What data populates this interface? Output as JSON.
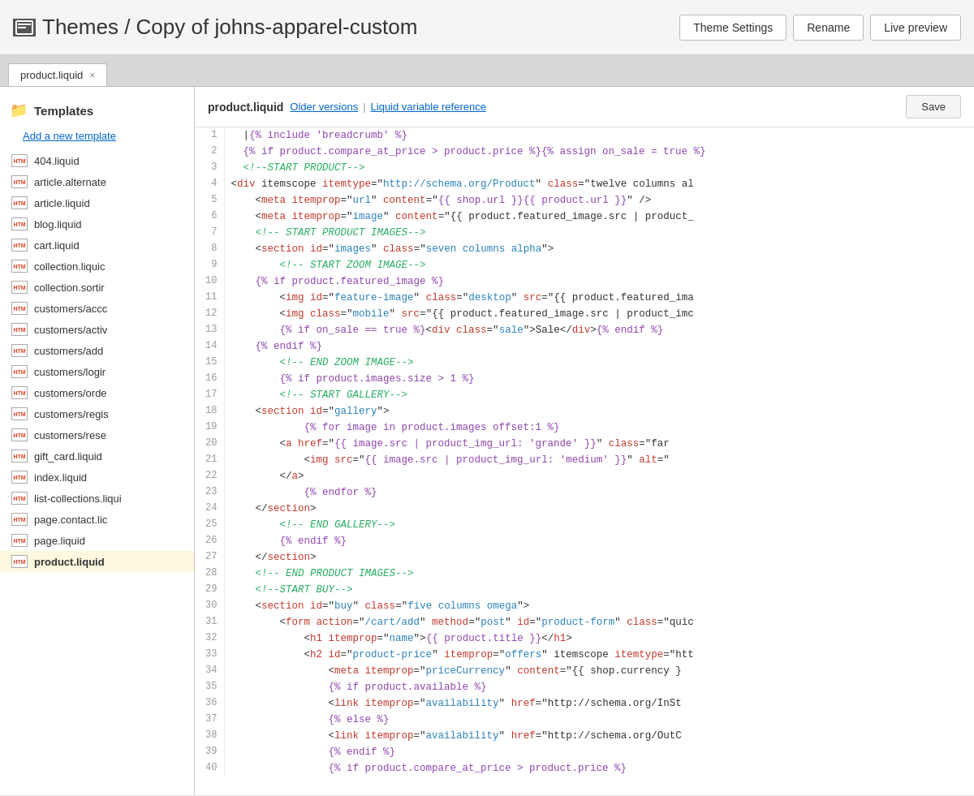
{
  "header": {
    "icon_label": "IMG",
    "title": "Themes / Copy of johns-apparel-custom",
    "theme_settings_label": "Theme Settings",
    "rename_label": "Rename",
    "live_preview_label": "Live preview"
  },
  "tabs": [
    {
      "label": "product.liquid",
      "active": true
    }
  ],
  "sidebar": {
    "section_label": "Templates",
    "add_new_label": "Add a new template",
    "items": [
      {
        "name": "404.liquid",
        "active": false
      },
      {
        "name": "article.alternate",
        "active": false
      },
      {
        "name": "article.liquid",
        "active": false
      },
      {
        "name": "blog.liquid",
        "active": false
      },
      {
        "name": "cart.liquid",
        "active": false
      },
      {
        "name": "collection.liquic",
        "active": false
      },
      {
        "name": "collection.sortir",
        "active": false
      },
      {
        "name": "customers/accc",
        "active": false
      },
      {
        "name": "customers/activ",
        "active": false
      },
      {
        "name": "customers/add",
        "active": false
      },
      {
        "name": "customers/logir",
        "active": false
      },
      {
        "name": "customers/orde",
        "active": false
      },
      {
        "name": "customers/regis",
        "active": false
      },
      {
        "name": "customers/rese",
        "active": false
      },
      {
        "name": "gift_card.liquid",
        "active": false
      },
      {
        "name": "index.liquid",
        "active": false
      },
      {
        "name": "list-collections.liqui",
        "active": false
      },
      {
        "name": "page.contact.lic",
        "active": false
      },
      {
        "name": "page.liquid",
        "active": false
      },
      {
        "name": "product.liquid",
        "active": true
      }
    ]
  },
  "editor": {
    "filename": "product.liquid",
    "older_versions_label": "Older versions",
    "liquid_ref_label": "Liquid variable reference",
    "save_label": "Save"
  },
  "code_lines": [
    {
      "num": 1,
      "raw": "  |{% include 'breadcrumb' %}"
    },
    {
      "num": 2,
      "raw": "  {% if product.compare_at_price > product.price %}{% assign on_sale = true %}"
    },
    {
      "num": 3,
      "raw": "  <!--START PRODUCT-->"
    },
    {
      "num": 4,
      "raw": "<div itemscope itemtype=\"http://schema.org/Product\" class=\"twelve columns al"
    },
    {
      "num": 5,
      "raw": "    <meta itemprop=\"url\" content=\"{{ shop.url }}{{ product.url }}\" />"
    },
    {
      "num": 6,
      "raw": "    <meta itemprop=\"image\" content=\"{{ product.featured_image.src | product_"
    },
    {
      "num": 7,
      "raw": "    <!-- START PRODUCT IMAGES-->"
    },
    {
      "num": 8,
      "raw": "    <section id=\"images\" class=\"seven columns alpha\">"
    },
    {
      "num": 9,
      "raw": "        <!-- START ZOOM IMAGE-->"
    },
    {
      "num": 10,
      "raw": "    {% if product.featured_image %}"
    },
    {
      "num": 11,
      "raw": "        <img id=\"feature-image\" class=\"desktop\" src=\"{{ product.featured_ima"
    },
    {
      "num": 12,
      "raw": "        <img class=\"mobile\" src=\"{{ product.featured_image.src | product_imc"
    },
    {
      "num": 13,
      "raw": "        {% if on_sale == true %}<div class=\"sale\">Sale</div>{% endif %}"
    },
    {
      "num": 14,
      "raw": "    {% endif %}"
    },
    {
      "num": 15,
      "raw": "        <!-- END ZOOM IMAGE-->"
    },
    {
      "num": 16,
      "raw": "        {% if product.images.size > 1 %}"
    },
    {
      "num": 17,
      "raw": "        <!-- START GALLERY-->"
    },
    {
      "num": 18,
      "raw": "    <section id=\"gallery\">"
    },
    {
      "num": 19,
      "raw": "            {% for image in product.images offset:1 %}"
    },
    {
      "num": 20,
      "raw": "        <a href=\"{{ image.src | product_img_url: 'grande' }}\" class=\"far"
    },
    {
      "num": 21,
      "raw": "            <img src=\"{{ image.src | product_img_url: 'medium' }}\" alt=\""
    },
    {
      "num": 22,
      "raw": "        </a>"
    },
    {
      "num": 23,
      "raw": "            {% endfor %}"
    },
    {
      "num": 24,
      "raw": "    </section>"
    },
    {
      "num": 25,
      "raw": "        <!-- END GALLERY-->"
    },
    {
      "num": 26,
      "raw": "        {% endif %}"
    },
    {
      "num": 27,
      "raw": "    </section>"
    },
    {
      "num": 28,
      "raw": "    <!-- END PRODUCT IMAGES-->"
    },
    {
      "num": 29,
      "raw": "    <!--START BUY-->"
    },
    {
      "num": 30,
      "raw": "    <section id=\"buy\" class=\"five columns omega\">"
    },
    {
      "num": 31,
      "raw": "        <form action=\"/cart/add\" method=\"post\" id=\"product-form\" class=\"quic"
    },
    {
      "num": 32,
      "raw": "            <h1 itemprop=\"name\">{{ product.title }}</h1>"
    },
    {
      "num": 33,
      "raw": "            <h2 id=\"product-price\" itemprop=\"offers\" itemscope itemtype=\"htt"
    },
    {
      "num": 34,
      "raw": "                <meta itemprop=\"priceCurrency\" content=\"{{ shop.currency }"
    },
    {
      "num": 35,
      "raw": "                {% if product.available %}"
    },
    {
      "num": 36,
      "raw": "                <link itemprop=\"availability\" href=\"http://schema.org/InSt"
    },
    {
      "num": 37,
      "raw": "                {% else %}"
    },
    {
      "num": 38,
      "raw": "                <link itemprop=\"availability\" href=\"http://schema.org/OutC"
    },
    {
      "num": 39,
      "raw": "                {% endif %}"
    },
    {
      "num": 40,
      "raw": "                {% if product.compare_at_price > product.price %}"
    }
  ]
}
